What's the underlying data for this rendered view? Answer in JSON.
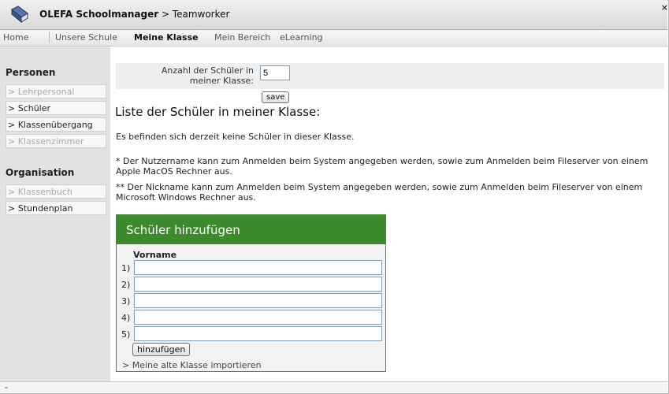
{
  "app": {
    "name": "OLEFA Schoolmanager",
    "subtitle": " > Teamworker",
    "close_label": "×"
  },
  "nav": {
    "items": [
      "Home",
      "Unsere Schule",
      "Meine Klasse",
      "Mein Bereich",
      "eLearning"
    ],
    "active": "Meine Klasse"
  },
  "sidebar": {
    "personen_heading": "Personen",
    "personen_items": [
      {
        "label": "> Lehrpersonal",
        "enabled": false
      },
      {
        "label": "> Schüler",
        "enabled": true
      },
      {
        "label": "> Klassenübergang",
        "enabled": true
      },
      {
        "label": "> Klassenzimmer",
        "enabled": false
      }
    ],
    "organisation_heading": "Organisation",
    "organisation_items": [
      {
        "label": "> Klassenbuch",
        "enabled": false
      },
      {
        "label": "> Stundenplan",
        "enabled": true
      }
    ]
  },
  "count": {
    "label": "Anzahl der Schüler in meiner Klasse:",
    "value": "5",
    "save_label": "save"
  },
  "list": {
    "title": "Liste der Schüler in meiner Klasse:",
    "empty_message": "Es befinden sich derzeit keine Schüler in dieser Klasse.",
    "note1": "* Der Nutzername kann zum Anmelden beim System angegeben werden, sowie zum Anmelden beim Fileserver von einem Apple MacOS Rechner aus.",
    "note2": "** Der Nickname kann zum Anmelden beim System angegeben werden, sowie zum Anmelden beim Fileserver von einem Microsoft Windows Rechner aus."
  },
  "add_box": {
    "title": "Schüler hinzufügen",
    "column_header": "Vorname",
    "rows": [
      "1)",
      "2)",
      "3)",
      "4)",
      "5)"
    ],
    "add_button_label": "hinzufügen",
    "import_link": "> Meine alte Klasse importieren"
  },
  "footer": {
    "text": "-"
  },
  "colors": {
    "accent_green": "#3d8a2e",
    "sidebar_bg": "#e2e2e2"
  },
  "icons": {
    "logo": "book-icon"
  }
}
